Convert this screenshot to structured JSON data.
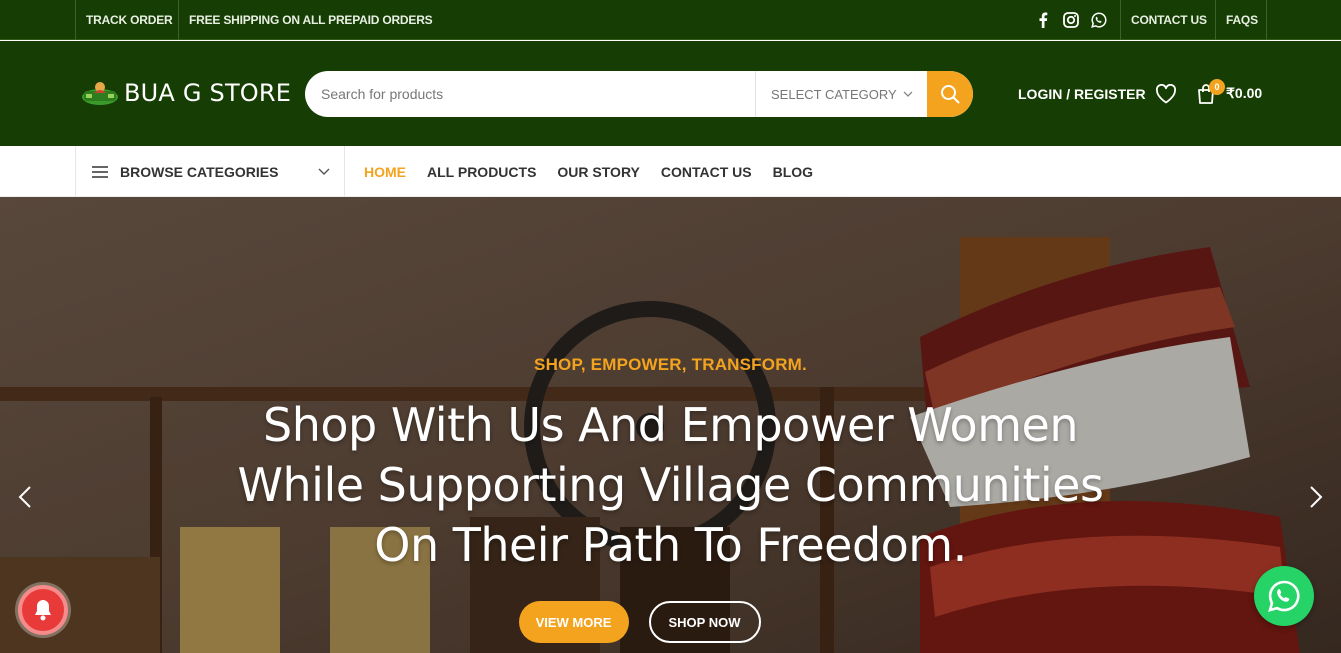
{
  "topbar": {
    "track_order": "TRACK ORDER",
    "shipping": "FREE SHIPPING ON ALL PREPAID ORDERS",
    "contact": "CONTACT US",
    "faqs": "FAQS",
    "social_icons": [
      "facebook-icon",
      "instagram-icon",
      "whatsapp-icon"
    ]
  },
  "header": {
    "logo_text": "BUA G STORE",
    "search_placeholder": "Search for products",
    "category_select": "SELECT CATEGORY",
    "login": "LOGIN / REGISTER",
    "cart_count": "0",
    "cart_total": "₹0.00"
  },
  "nav": {
    "browse": "BROWSE CATEGORIES",
    "items": [
      {
        "label": "HOME",
        "active": true
      },
      {
        "label": "ALL PRODUCTS",
        "active": false
      },
      {
        "label": "OUR STORY",
        "active": false
      },
      {
        "label": "CONTACT US",
        "active": false
      },
      {
        "label": "BLOG",
        "active": false
      }
    ]
  },
  "hero": {
    "eyebrow": "SHOP, EMPOWER, TRANSFORM.",
    "headline_lines": [
      "Shop With Us And Empower Women",
      "While Supporting Village Communities",
      "On Their Path To Freedom."
    ],
    "primary_button": "VIEW MORE",
    "secondary_button": "SHOP NOW"
  },
  "colors": {
    "brand_green": "#163d04",
    "accent_orange": "#f4a31f",
    "whatsapp_green": "#25d366",
    "notification_red": "#e93a3a"
  }
}
